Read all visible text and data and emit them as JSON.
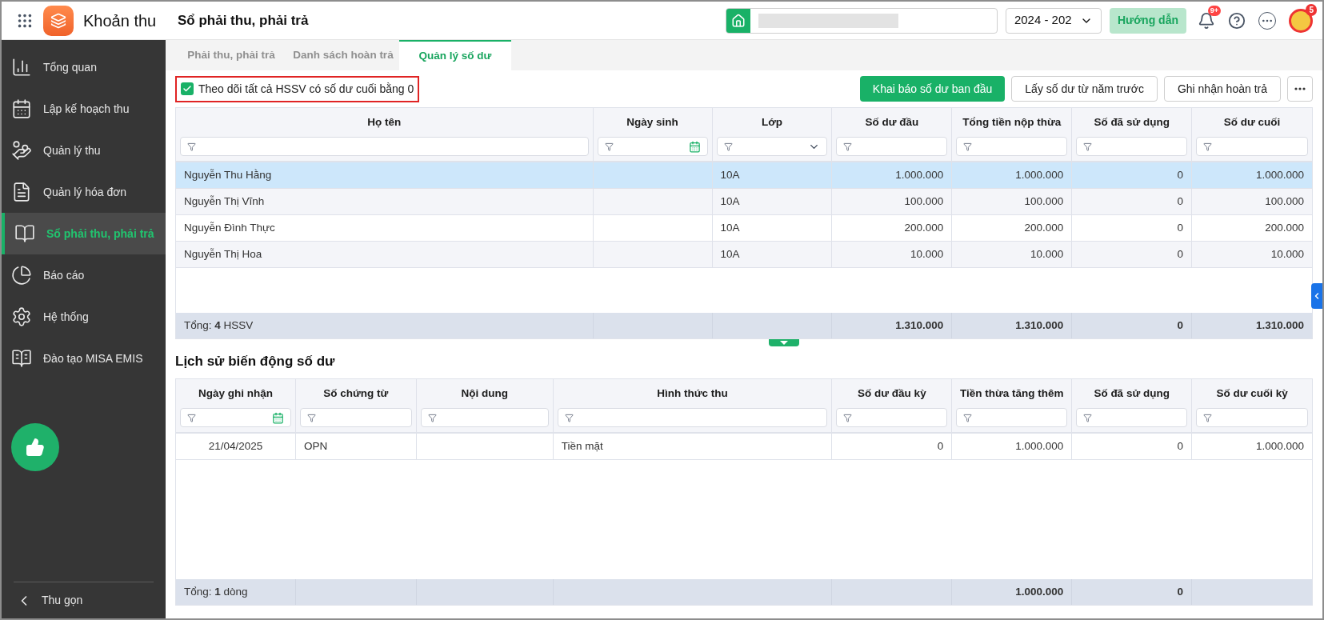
{
  "app": {
    "name": "Khoản thu"
  },
  "page_title": "Sổ phải thu, phải trả",
  "year_select": {
    "value": "2024 - 202"
  },
  "guide_button": "Hướng dẫn",
  "notification_badge": "9+",
  "avatar_badge": "5",
  "sidebar": {
    "items": [
      {
        "label": "Tổng quan",
        "selected": false
      },
      {
        "label": "Lập kế hoạch thu",
        "selected": false
      },
      {
        "label": "Quản lý thu",
        "selected": false
      },
      {
        "label": "Quản lý hóa đơn",
        "selected": false
      },
      {
        "label": "Sổ phải thu, phải trả",
        "selected": true
      },
      {
        "label": "Báo cáo",
        "selected": false
      },
      {
        "label": "Hệ thống",
        "selected": false
      },
      {
        "label": "Đào tạo MISA EMIS",
        "selected": false
      }
    ],
    "collapse": "Thu gọn"
  },
  "tabs": [
    {
      "label": "Phải thu, phải trả",
      "selected": false
    },
    {
      "label": "Danh sách hoàn trả",
      "selected": false
    },
    {
      "label": "Quản lý số dư",
      "selected": true
    }
  ],
  "checkbox": {
    "label": "Theo dõi tất cả HSSV có số dư cuối bằng 0",
    "checked": true,
    "highlighted": true
  },
  "actions": [
    {
      "label": "Khai báo số dư ban đầu",
      "kind": "primary"
    },
    {
      "label": "Lấy số dư từ năm trước",
      "kind": "secondary"
    },
    {
      "label": "Ghi nhận hoàn trả",
      "kind": "secondary"
    }
  ],
  "balance_table": {
    "columns": [
      {
        "label": "Họ tên",
        "kind": "text"
      },
      {
        "label": "Ngày sinh",
        "kind": "date"
      },
      {
        "label": "Lớp",
        "kind": "select"
      },
      {
        "label": "Số dư đầu",
        "kind": "number"
      },
      {
        "label": "Tổng tiền nộp thừa",
        "kind": "number"
      },
      {
        "label": "Số đã sử dụng",
        "kind": "number"
      },
      {
        "label": "Số dư cuối",
        "kind": "number"
      }
    ],
    "rows": [
      {
        "selected": true,
        "cells": [
          "Nguyễn Thu Hằng",
          null,
          "10A",
          "1.000.000",
          "1.000.000",
          "0",
          "1.000.000"
        ]
      },
      {
        "selected": false,
        "cells": [
          "Nguyễn Thị Vĩnh",
          null,
          "10A",
          "100.000",
          "100.000",
          "0",
          "100.000"
        ]
      },
      {
        "selected": false,
        "cells": [
          "Nguyễn Đình Thực",
          null,
          "10A",
          "200.000",
          "200.000",
          "0",
          "200.000"
        ]
      },
      {
        "selected": false,
        "cells": [
          "Nguyễn Thị Hoa",
          null,
          "10A",
          "10.000",
          "10.000",
          "0",
          "10.000"
        ]
      }
    ],
    "footer": [
      {
        "kind": "label",
        "text": "Tổng: **4** HSSV"
      },
      {
        "kind": "blank"
      },
      {
        "kind": "blank"
      },
      {
        "kind": "total",
        "text": "1.310.000"
      },
      {
        "kind": "total",
        "text": "1.310.000"
      },
      {
        "kind": "total",
        "text": "0"
      },
      {
        "kind": "total",
        "text": "1.310.000"
      }
    ]
  },
  "history": {
    "title": "Lịch sử biến động số dư",
    "columns": [
      {
        "label": "Ngày ghi nhận",
        "kind": "date"
      },
      {
        "label": "Số chứng từ",
        "kind": "text"
      },
      {
        "label": "Nội dung",
        "kind": "text"
      },
      {
        "label": "Hình thức thu",
        "kind": "text"
      },
      {
        "label": "Số dư đầu kỳ",
        "kind": "number"
      },
      {
        "label": "Tiền thừa tăng thêm",
        "kind": "number"
      },
      {
        "label": "Số đã sử dụng",
        "kind": "number"
      },
      {
        "label": "Số dư cuối kỳ",
        "kind": "number"
      }
    ],
    "rows": [
      {
        "selected": false,
        "cells": [
          "21/04/2025",
          "OPN",
          null,
          "Tiền mặt",
          "0",
          "1.000.000",
          "0",
          "1.000.000"
        ]
      }
    ],
    "footer": [
      {
        "kind": "label",
        "text": "Tổng: **1** dòng"
      },
      {
        "kind": "blank"
      },
      {
        "kind": "blank"
      },
      {
        "kind": "blank"
      },
      {
        "kind": "blank"
      },
      {
        "kind": "total",
        "text": "1.000.000"
      },
      {
        "kind": "total",
        "text": "0"
      },
      {
        "kind": "blank"
      }
    ]
  }
}
